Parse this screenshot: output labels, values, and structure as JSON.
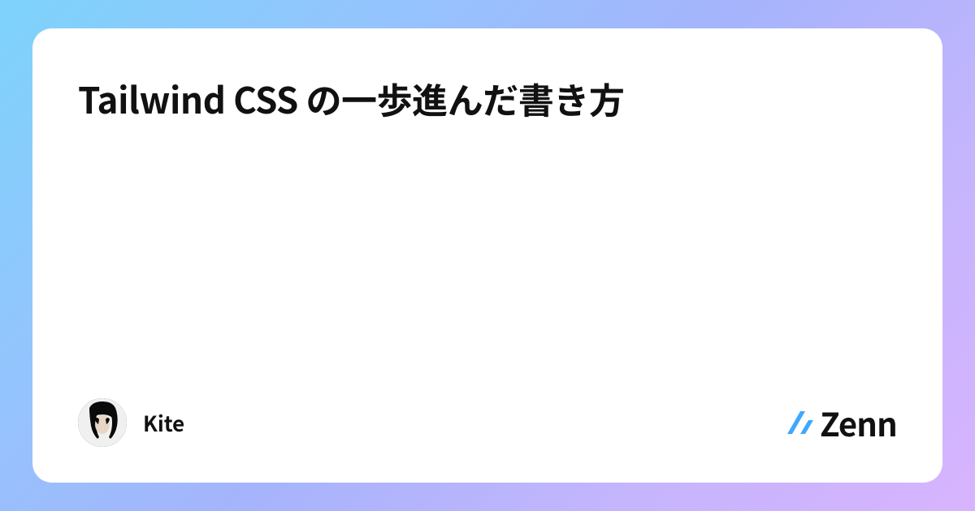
{
  "card": {
    "title": "Tailwind CSS の一歩進んだ書き方",
    "author": {
      "name": "Kite"
    },
    "platform": {
      "name": "Zenn"
    }
  }
}
